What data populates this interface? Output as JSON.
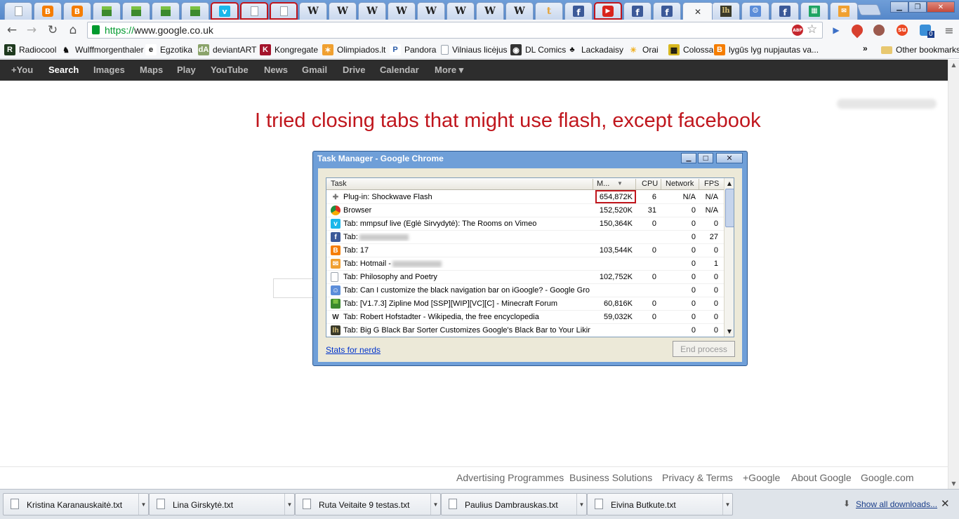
{
  "browser": {
    "tabs": [
      {
        "icon": "document-icon"
      },
      {
        "icon": "blogger-icon"
      },
      {
        "icon": "blogger-icon"
      },
      {
        "icon": "minecraft-icon"
      },
      {
        "icon": "minecraft-icon"
      },
      {
        "icon": "minecraft-icon"
      },
      {
        "icon": "minecraft-icon"
      },
      {
        "icon": "vimeo-icon"
      },
      {
        "icon": "document-icon"
      },
      {
        "icon": "document-icon"
      },
      {
        "icon": "wikipedia-icon"
      },
      {
        "icon": "wikipedia-icon"
      },
      {
        "icon": "wikipedia-icon"
      },
      {
        "icon": "wikipedia-icon"
      },
      {
        "icon": "wikipedia-icon"
      },
      {
        "icon": "wikipedia-icon"
      },
      {
        "icon": "wikipedia-icon"
      },
      {
        "icon": "wikipedia-icon"
      },
      {
        "icon": "tumblr-icon"
      },
      {
        "icon": "facebook-icon"
      },
      {
        "icon": "youtube-icon"
      },
      {
        "icon": "facebook-icon"
      },
      {
        "icon": "facebook-icon"
      },
      {
        "icon": "google-active-tab"
      },
      {
        "icon": "lifehacker-icon"
      },
      {
        "icon": "google-groups-icon"
      },
      {
        "icon": "facebook-icon"
      },
      {
        "icon": "spreadsheet-icon"
      },
      {
        "icon": "hotmail-icon"
      }
    ],
    "active_tab_close": "✕",
    "highlight_color": "#c0161d",
    "url_scheme": "https://",
    "url_host": "www.google.co.uk",
    "extensions": {
      "abp": "ABP",
      "counter": "0"
    }
  },
  "bookmarks": [
    {
      "label": "Radiocool",
      "icon": "radiocool-icon"
    },
    {
      "label": "Wulffmorgenthaler",
      "icon": "wulffmorgenthaler-icon"
    },
    {
      "label": "Egzotika",
      "icon": "egzotika-icon"
    },
    {
      "label": "deviantART",
      "icon": "deviantart-icon"
    },
    {
      "label": "Kongregate",
      "icon": "kongregate-icon"
    },
    {
      "label": "Olimpiados.lt",
      "icon": "olimpiados-icon"
    },
    {
      "label": "Pandora",
      "icon": "pandora-icon"
    },
    {
      "label": "Vilniaus licėjus",
      "icon": "document-icon"
    },
    {
      "label": "DL Comics",
      "icon": "dl-comics-icon"
    },
    {
      "label": "Lackadaisy",
      "icon": "lackadaisy-icon"
    },
    {
      "label": "Orai",
      "icon": "weather-icon"
    },
    {
      "label": "Colossal",
      "icon": "colossal-icon"
    },
    {
      "label": "lygūs lyg nupjautas va...",
      "icon": "blogger-icon"
    }
  ],
  "bookmarks_overflow": "»",
  "other_bookmarks": "Other bookmarks",
  "google_bar": [
    "+You",
    "Search",
    "Images",
    "Maps",
    "Play",
    "YouTube",
    "News",
    "Gmail",
    "Drive",
    "Calendar",
    "More ▾"
  ],
  "google_bar_active": "Search",
  "annotation": "I tried closing tabs that might use flash, except facebook",
  "task_manager": {
    "title": "Task Manager - Google Chrome",
    "columns": {
      "task": "Task",
      "memory": "M...",
      "cpu": "CPU",
      "network": "Network",
      "fps": "FPS"
    },
    "rows": [
      {
        "icon": "plugin-icon",
        "task": "Plug-in: Shockwave Flash",
        "memory": "654,872K",
        "cpu": "6",
        "network": "N/A",
        "fps": "N/A"
      },
      {
        "icon": "chrome-icon",
        "task": "Browser",
        "memory": "152,520K",
        "cpu": "31",
        "network": "0",
        "fps": "N/A"
      },
      {
        "icon": "vimeo-icon",
        "task": "Tab: mmpsuf live (Eglė Sirvydytė): The Rooms on Vimeo",
        "memory": "150,364K",
        "cpu": "0",
        "network": "0",
        "fps": "0"
      },
      {
        "icon": "facebook-icon",
        "task": "Tab:",
        "memory": "",
        "cpu": "",
        "network": "0",
        "fps": "27",
        "blurred": true
      },
      {
        "icon": "blogger-icon",
        "task": "Tab: 17",
        "memory": "103,544K",
        "cpu": "0",
        "network": "0",
        "fps": "0"
      },
      {
        "icon": "hotmail-icon",
        "task": "Tab: Hotmail -",
        "memory": "",
        "cpu": "",
        "network": "0",
        "fps": "1",
        "blurred": true
      },
      {
        "icon": "document-icon",
        "task": "Tab: Philosophy and Poetry",
        "memory": "102,752K",
        "cpu": "0",
        "network": "0",
        "fps": "0"
      },
      {
        "icon": "google-groups-icon",
        "task": "Tab: Can I customize the black navigation bar on iGoogle? - Google Gro...",
        "memory": "",
        "cpu": "",
        "network": "0",
        "fps": "0"
      },
      {
        "icon": "minecraft-icon",
        "task": "Tab: [V1.7.3] Zipline Mod [SSP][WIP][VC][C] - Minecraft Forum",
        "memory": "60,816K",
        "cpu": "0",
        "network": "0",
        "fps": "0"
      },
      {
        "icon": "wikipedia-icon",
        "task": "Tab: Robert Hofstadter - Wikipedia, the free encyclopedia",
        "memory": "59,032K",
        "cpu": "0",
        "network": "0",
        "fps": "0"
      },
      {
        "icon": "lifehacker-icon",
        "task": "Tab: Big G Black Bar Sorter Customizes Google's Black Bar to Your Liking",
        "memory": "",
        "cpu": "",
        "network": "0",
        "fps": "0"
      }
    ],
    "stats_link": "Stats for nerds",
    "end_process": "End process"
  },
  "footer_links": [
    "Advertising Programmes",
    "Business Solutions",
    "Privacy & Terms",
    "+Google",
    "About Google",
    "Google.com"
  ],
  "downloads": [
    "Kristina Karanauskaitė.txt",
    "Lina Girskytė.txt",
    "Ruta Veitaite 9 testas.txt",
    "Paulius Dambrauskas.txt",
    "Eivina Butkute.txt"
  ],
  "show_all_downloads": "Show all downloads...",
  "colors": {
    "annotation": "#c0161d",
    "google_bar": "#2d2d2d",
    "url_scheme": "#009a2e",
    "link": "#0033cc"
  }
}
